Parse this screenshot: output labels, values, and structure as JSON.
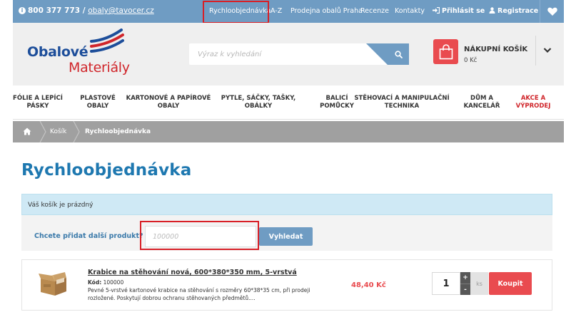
{
  "topbar": {
    "phone": "800 377 773",
    "separator": " / ",
    "email": "obaly@tavocer.cz",
    "links": [
      "Rychloobjednávka",
      "A-Z",
      "Prodejna obalů Praha",
      "Recenze",
      "Kontakty"
    ],
    "login": "Přihlásit se",
    "register": "Registrace",
    "icons": [
      "info-icon",
      "sign-in-icon",
      "user-icon",
      "heart-icon"
    ]
  },
  "header": {
    "logo_line1": "Obalové",
    "logo_line2": "Materiály",
    "search_placeholder": "Výraz k vyhledání",
    "cart_title": "NÁKUPNÍ KOŠÍK",
    "cart_price": "0 Kč"
  },
  "categories": [
    {
      "label": "FÓLIE A LEPÍCÍ PÁSKY"
    },
    {
      "label": "PLASTOVÉ OBALY"
    },
    {
      "label": "KARTONOVÉ A PAPÍROVÉ OBALY"
    },
    {
      "label": "PYTLE, SÁČKY, TAŠKY, OBÁLKY"
    },
    {
      "label": "BALICÍ POMŮCKY"
    },
    {
      "label": "STĚHOVACÍ A MANIPULAČNÍ TECHNIKA"
    },
    {
      "label": "DŮM A KANCELÁŘ"
    },
    {
      "label": "AKCE A VÝPRODEJ"
    }
  ],
  "breadcrumb": [
    "Košík",
    "Rychloobjednávka"
  ],
  "page": {
    "title": "Rychloobjednávka",
    "alert": "Váš košík je prázdný",
    "add_label": "Chcete přidat další produkt?",
    "add_placeholder": "100000",
    "search_button": "Vyhledat"
  },
  "product": {
    "name": "Krabice na stěhování nová, 600*380*350 mm, 5-vrstvá",
    "code_label": "Kód:",
    "code": "100000",
    "description": "Pevné 5-vrstvé kartonové krabice na stěhování s rozměry 60*38*35 cm, při prodeji rozložené. Poskytují dobrou ochranu stěhovaných předmětů....",
    "price": "48,40 Kč",
    "quantity": "1",
    "plus": "+",
    "minus": "-",
    "unit": "ks",
    "buy_button": "Koupit"
  },
  "colors": {
    "accent_blue": "#6f9cc3",
    "title_blue": "#1e78b0",
    "red": "#e94b4f",
    "highlight_box": "#d81f26"
  }
}
